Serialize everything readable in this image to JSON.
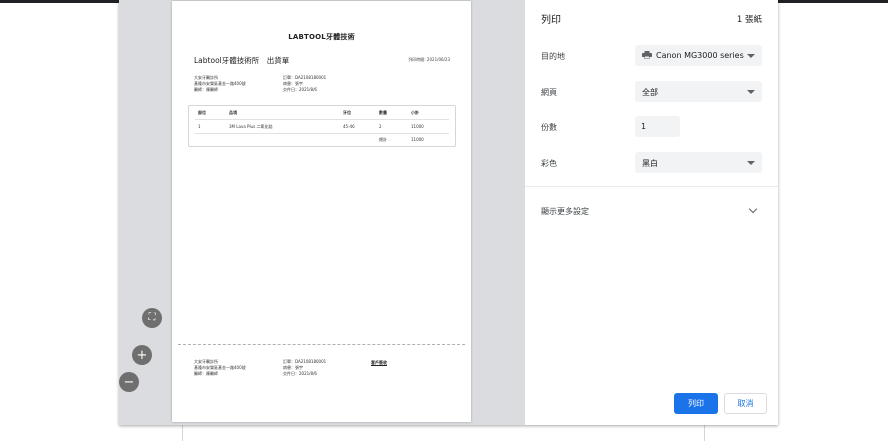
{
  "paper": {
    "brand": "LABTOOL牙體技術",
    "clinic_title": "Labtool牙體技術所　出貨單",
    "print_date": "列印時間: 2021/06/23",
    "left_info": [
      "大安牙醫診所",
      "基隆市安樂區基金一路400號",
      "醫師：陳醫師"
    ],
    "right_info": [
      "訂單：DA2108180001",
      "病患：張宇",
      "交件日：2021/8/6"
    ],
    "table": {
      "headers": [
        "部位",
        "品項",
        "牙位",
        "數量",
        "小計"
      ],
      "row": [
        "1",
        "3M Lava Plus 二氧化鋯",
        "45-46",
        "2",
        "11000"
      ],
      "total_label": "總計",
      "total_value": "11000"
    },
    "footer_left": [
      "大安牙醫診所",
      "基隆市安樂區基金一路400號",
      "醫師：陳醫師"
    ],
    "footer_right": [
      "訂單：DA2108180001",
      "病患：張宇",
      "交件日：2021/8/6"
    ],
    "signature": "客戶簽收"
  },
  "zoom": {
    "fit": "⛶",
    "zoom_in": "+",
    "zoom_out": "−"
  },
  "settings": {
    "title": "列印",
    "sheets": "1 張紙",
    "destination_label": "目的地",
    "destination_value": "Canon MG3000 series",
    "pages_label": "網頁",
    "pages_value": "全部",
    "copies_label": "份數",
    "copies_value": "1",
    "color_label": "彩色",
    "color_value": "黑白",
    "more_settings": "顯示更多設定",
    "print_button": "列印",
    "cancel_button": "取消"
  },
  "colors": {
    "accent": "#1a73e8",
    "preview_bg": "#dadce0"
  }
}
